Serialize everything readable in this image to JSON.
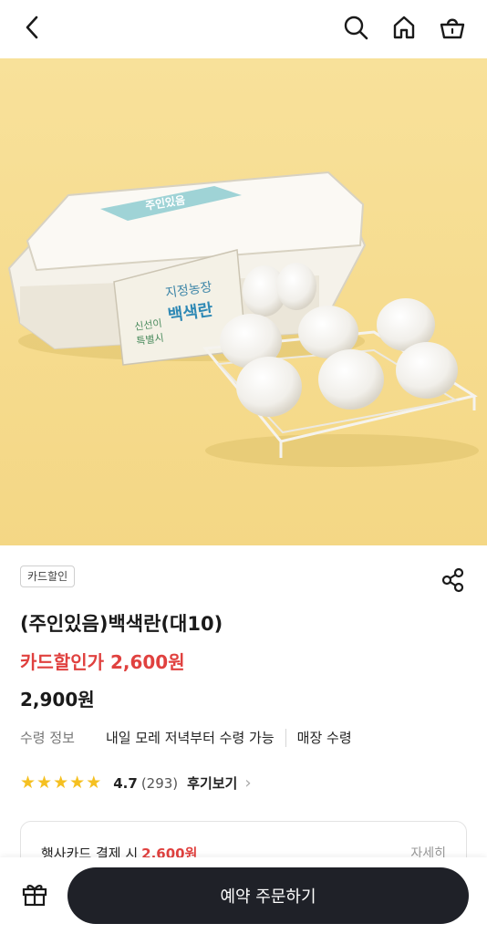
{
  "header": {
    "back_icon": "chevron-left-icon",
    "search_icon": "search-icon",
    "home_icon": "home-icon",
    "cart_icon": "shopping-basket-icon"
  },
  "product": {
    "badge": "카드할인",
    "title": "(주인있음)백색란(대10)",
    "sale_price": "카드할인가 2,600원",
    "price": "2,900원",
    "pickup": {
      "label": "수령 정보",
      "option1": "내일 모레 저녁부터 수령 가능",
      "option2": "매장 수령"
    },
    "rating": {
      "stars": "★★★★★",
      "score": "4.7",
      "count": "(293)",
      "reviews_label": "후기보기"
    },
    "card_offer": {
      "text": "행사카드 결제 시",
      "amount": "2,600원",
      "detail": "자세히"
    }
  },
  "package": {
    "brand": "주인있음",
    "farm": "지정농장",
    "product": "백색란",
    "slogan_1": "신선이",
    "slogan_2": "특별시"
  },
  "bottom_bar": {
    "gift_icon": "gift-icon",
    "order_label": "예약 주문하기"
  },
  "colors": {
    "accent_red": "#e0413f",
    "button_dark": "#1f2128",
    "hero_bg": "#f6dd8e"
  }
}
